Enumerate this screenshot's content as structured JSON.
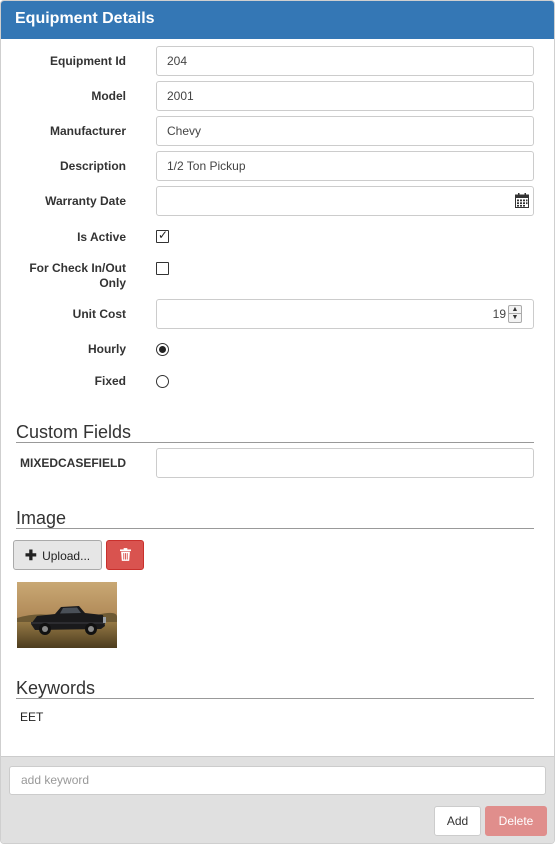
{
  "header": {
    "title": "Equipment Details"
  },
  "fields": {
    "equipment_id": {
      "label": "Equipment Id",
      "value": "204"
    },
    "model": {
      "label": "Model",
      "value": "2001"
    },
    "manufacturer": {
      "label": "Manufacturer",
      "value": "Chevy"
    },
    "description": {
      "label": "Description",
      "value": "1/2 Ton Pickup"
    },
    "warranty_date": {
      "label": "Warranty Date",
      "value": "",
      "icon": "calendar-icon"
    },
    "is_active": {
      "label": "Is Active",
      "checked": true
    },
    "check_in_out": {
      "label_line1": "For Check In/Out",
      "label_line2": "Only",
      "checked": false
    },
    "unit_cost": {
      "label": "Unit Cost",
      "value": "19"
    },
    "hourly": {
      "label": "Hourly",
      "selected": true
    },
    "fixed": {
      "label": "Fixed",
      "selected": false
    }
  },
  "custom_fields": {
    "title": "Custom Fields",
    "mixedcasefield": {
      "label": "MIXEDCASEFIELD",
      "value": ""
    }
  },
  "image_section": {
    "title": "Image",
    "upload_label": "Upload...",
    "upload_icon": "plus-icon",
    "delete_icon": "trash-icon"
  },
  "keywords": {
    "title": "Keywords",
    "items": [
      "EET"
    ],
    "input_placeholder": "add keyword",
    "add_label": "Add",
    "delete_label": "Delete"
  },
  "colors": {
    "header_bg": "#3477b5",
    "danger": "#d9534f",
    "danger_disabled": "#e08e8c"
  }
}
